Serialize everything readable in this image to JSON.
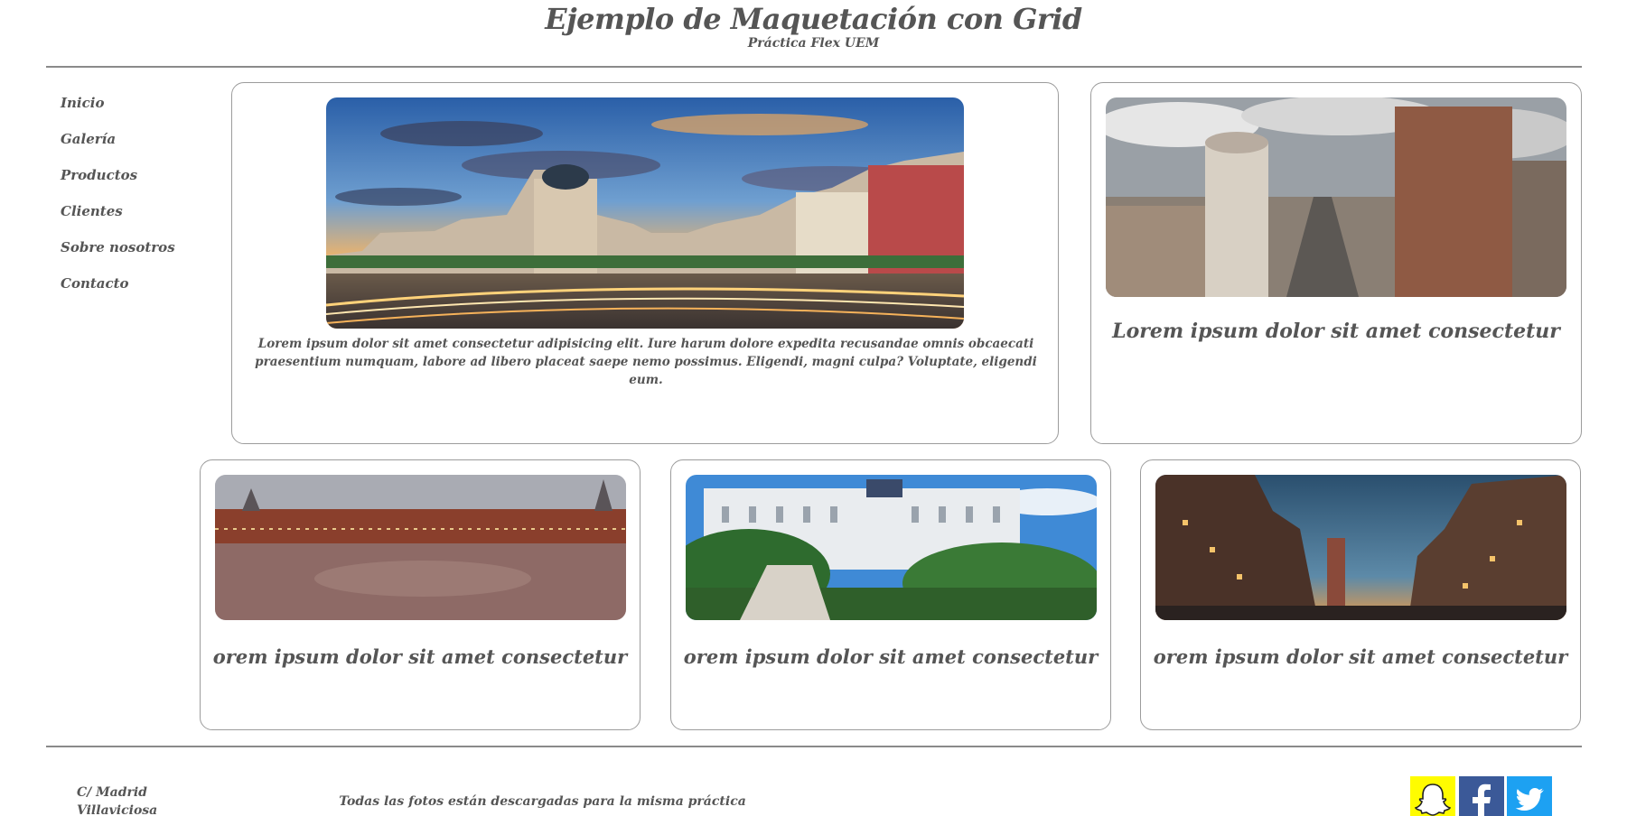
{
  "header": {
    "title": "Ejemplo de Maquetación con Grid",
    "subtitle": "Práctica Flex UEM"
  },
  "nav": {
    "items": [
      "Inicio",
      "Galería",
      "Productos",
      "Clientes",
      "Sobre nosotros",
      "Contacto"
    ]
  },
  "cards": {
    "main": {
      "text": "Lorem ipsum dolor sit amet consectetur adipisicing elit. Iure harum dolore expedita recusandae omnis obcaecati praesentium numquam, labore ad libero placeat saepe nemo possimus. Eligendi, magni culpa? Voluptate, eligendi eum."
    },
    "right": {
      "text": "Lorem ipsum dolor sit amet consectetur"
    },
    "small": [
      {
        "text": "orem ipsum dolor sit amet consectetur"
      },
      {
        "text": "orem ipsum dolor sit amet consectetur"
      },
      {
        "text": "orem ipsum dolor sit amet consectetur"
      }
    ]
  },
  "footer": {
    "address_line1": "C/ Madrid",
    "address_line2": "Villaviciosa",
    "note": "Todas las fotos están descargadas para la misma práctica"
  },
  "social": {
    "icons": [
      "snapchat-icon",
      "facebook-icon",
      "twitter-icon"
    ],
    "colors": {
      "snapchat": "#fffc00",
      "facebook": "#3b5998",
      "twitter": "#1da1f2"
    }
  },
  "colors": {
    "text": "#555555",
    "border": "#9c9c9c",
    "rule": "#8a8a8a"
  }
}
